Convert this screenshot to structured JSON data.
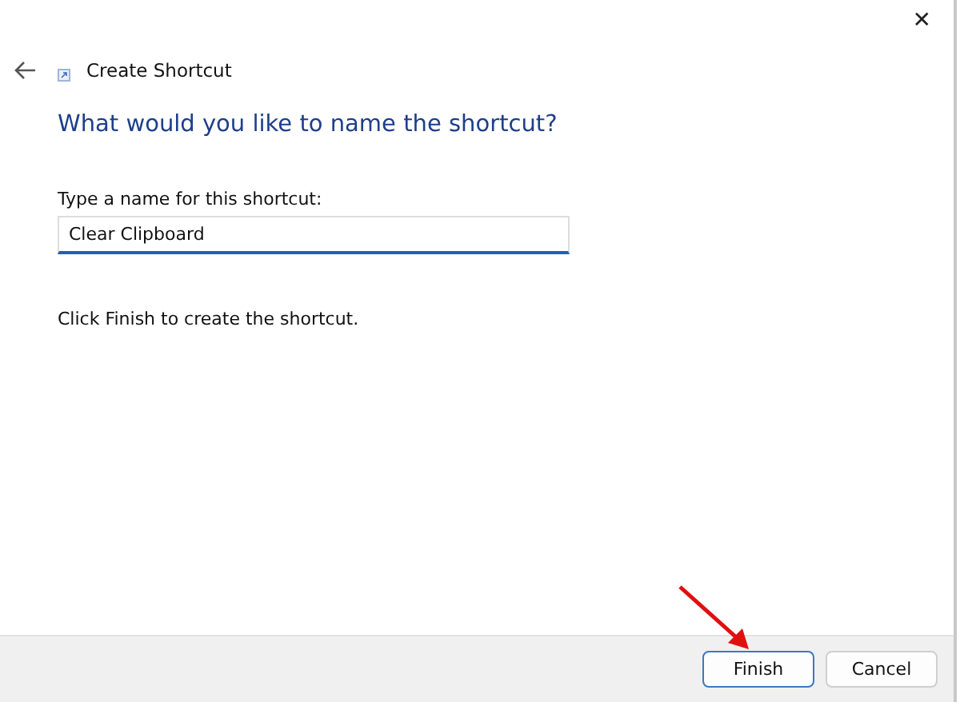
{
  "window": {
    "title": "Create Shortcut",
    "close": "✕"
  },
  "heading": "What would you like to name the shortcut?",
  "name_field": {
    "label": "Type a name for this shortcut:",
    "value": "Clear Clipboard"
  },
  "hint": "Click Finish to create the shortcut.",
  "buttons": [
    {
      "label": "Finish",
      "default": true
    },
    {
      "label": "Cancel",
      "default": false
    }
  ]
}
